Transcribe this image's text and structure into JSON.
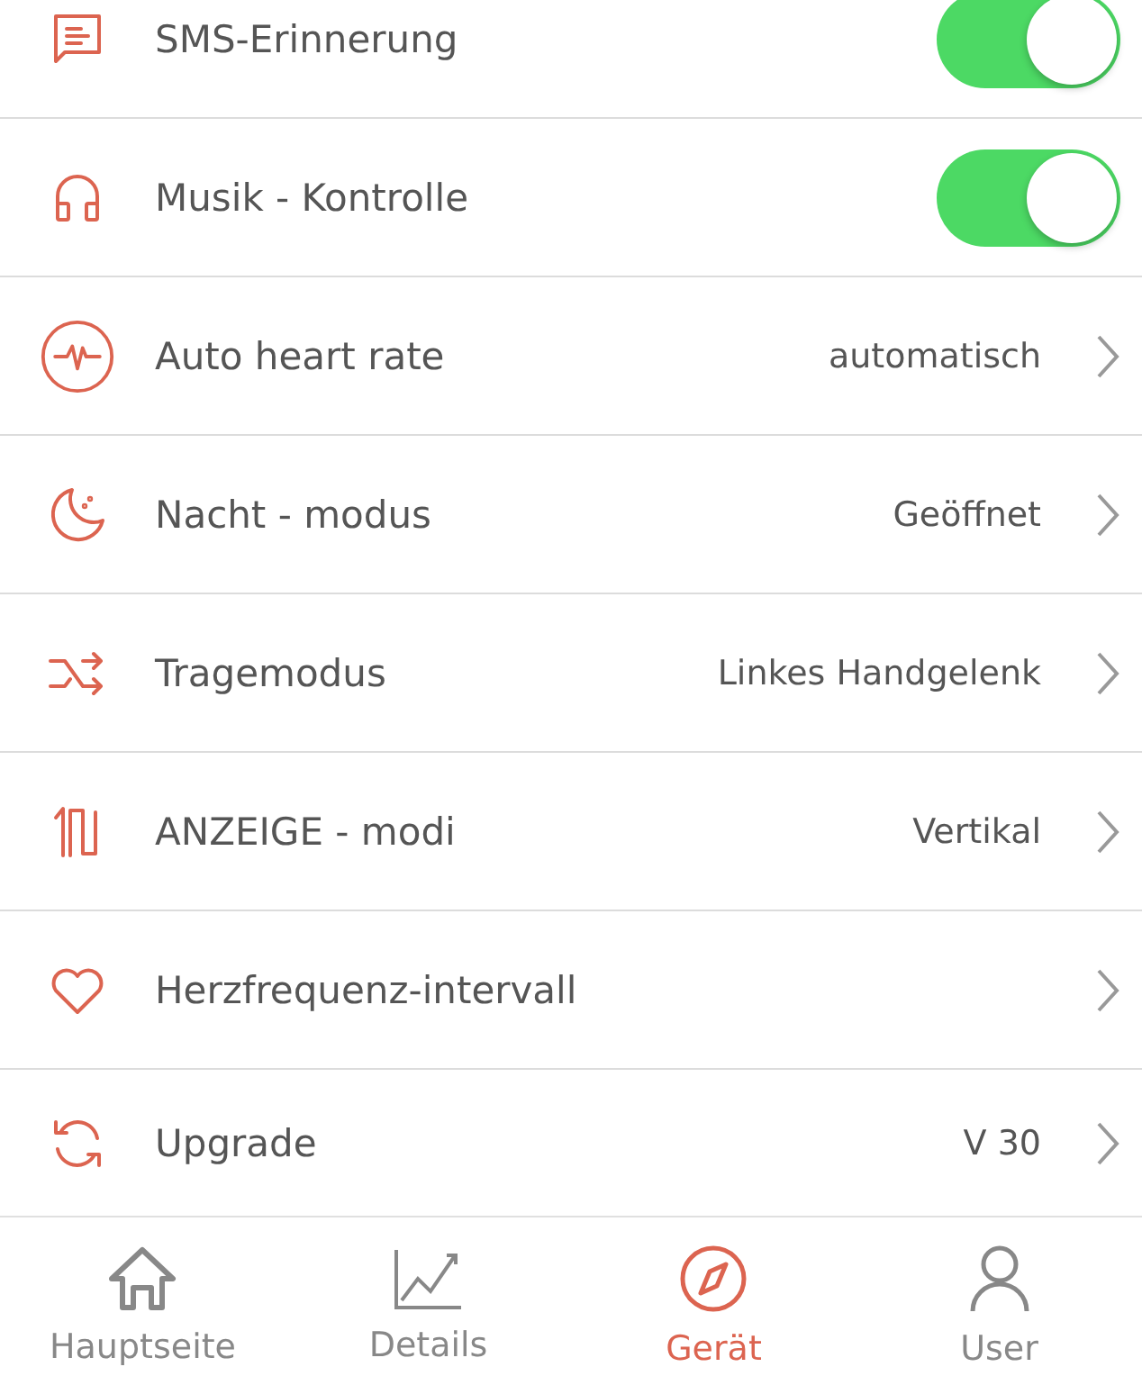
{
  "settings": [
    {
      "kind": "toggle",
      "label": "SMS-Erinnerung",
      "on": true
    },
    {
      "kind": "toggle",
      "label": "Musik - Kontrolle",
      "on": true
    },
    {
      "kind": "link",
      "label": "Auto heart rate",
      "value": "automatisch"
    },
    {
      "kind": "link",
      "label": "Nacht - modus",
      "value": "Geöffnet"
    },
    {
      "kind": "link",
      "label": "Tragemodus",
      "value": "Linkes Handgelenk"
    },
    {
      "kind": "link",
      "label": "ANZEIGE - modi",
      "value": "Vertikal"
    },
    {
      "kind": "link",
      "label": "Herzfrequenz-intervall"
    },
    {
      "kind": "link",
      "label": "Upgrade",
      "value": "V 30"
    }
  ],
  "tab_bar": [
    {
      "label": "Hauptseite",
      "selected": false
    },
    {
      "label": "Details",
      "selected": false
    },
    {
      "label": "Gerät",
      "selected": true
    },
    {
      "label": "User",
      "selected": false
    }
  ]
}
